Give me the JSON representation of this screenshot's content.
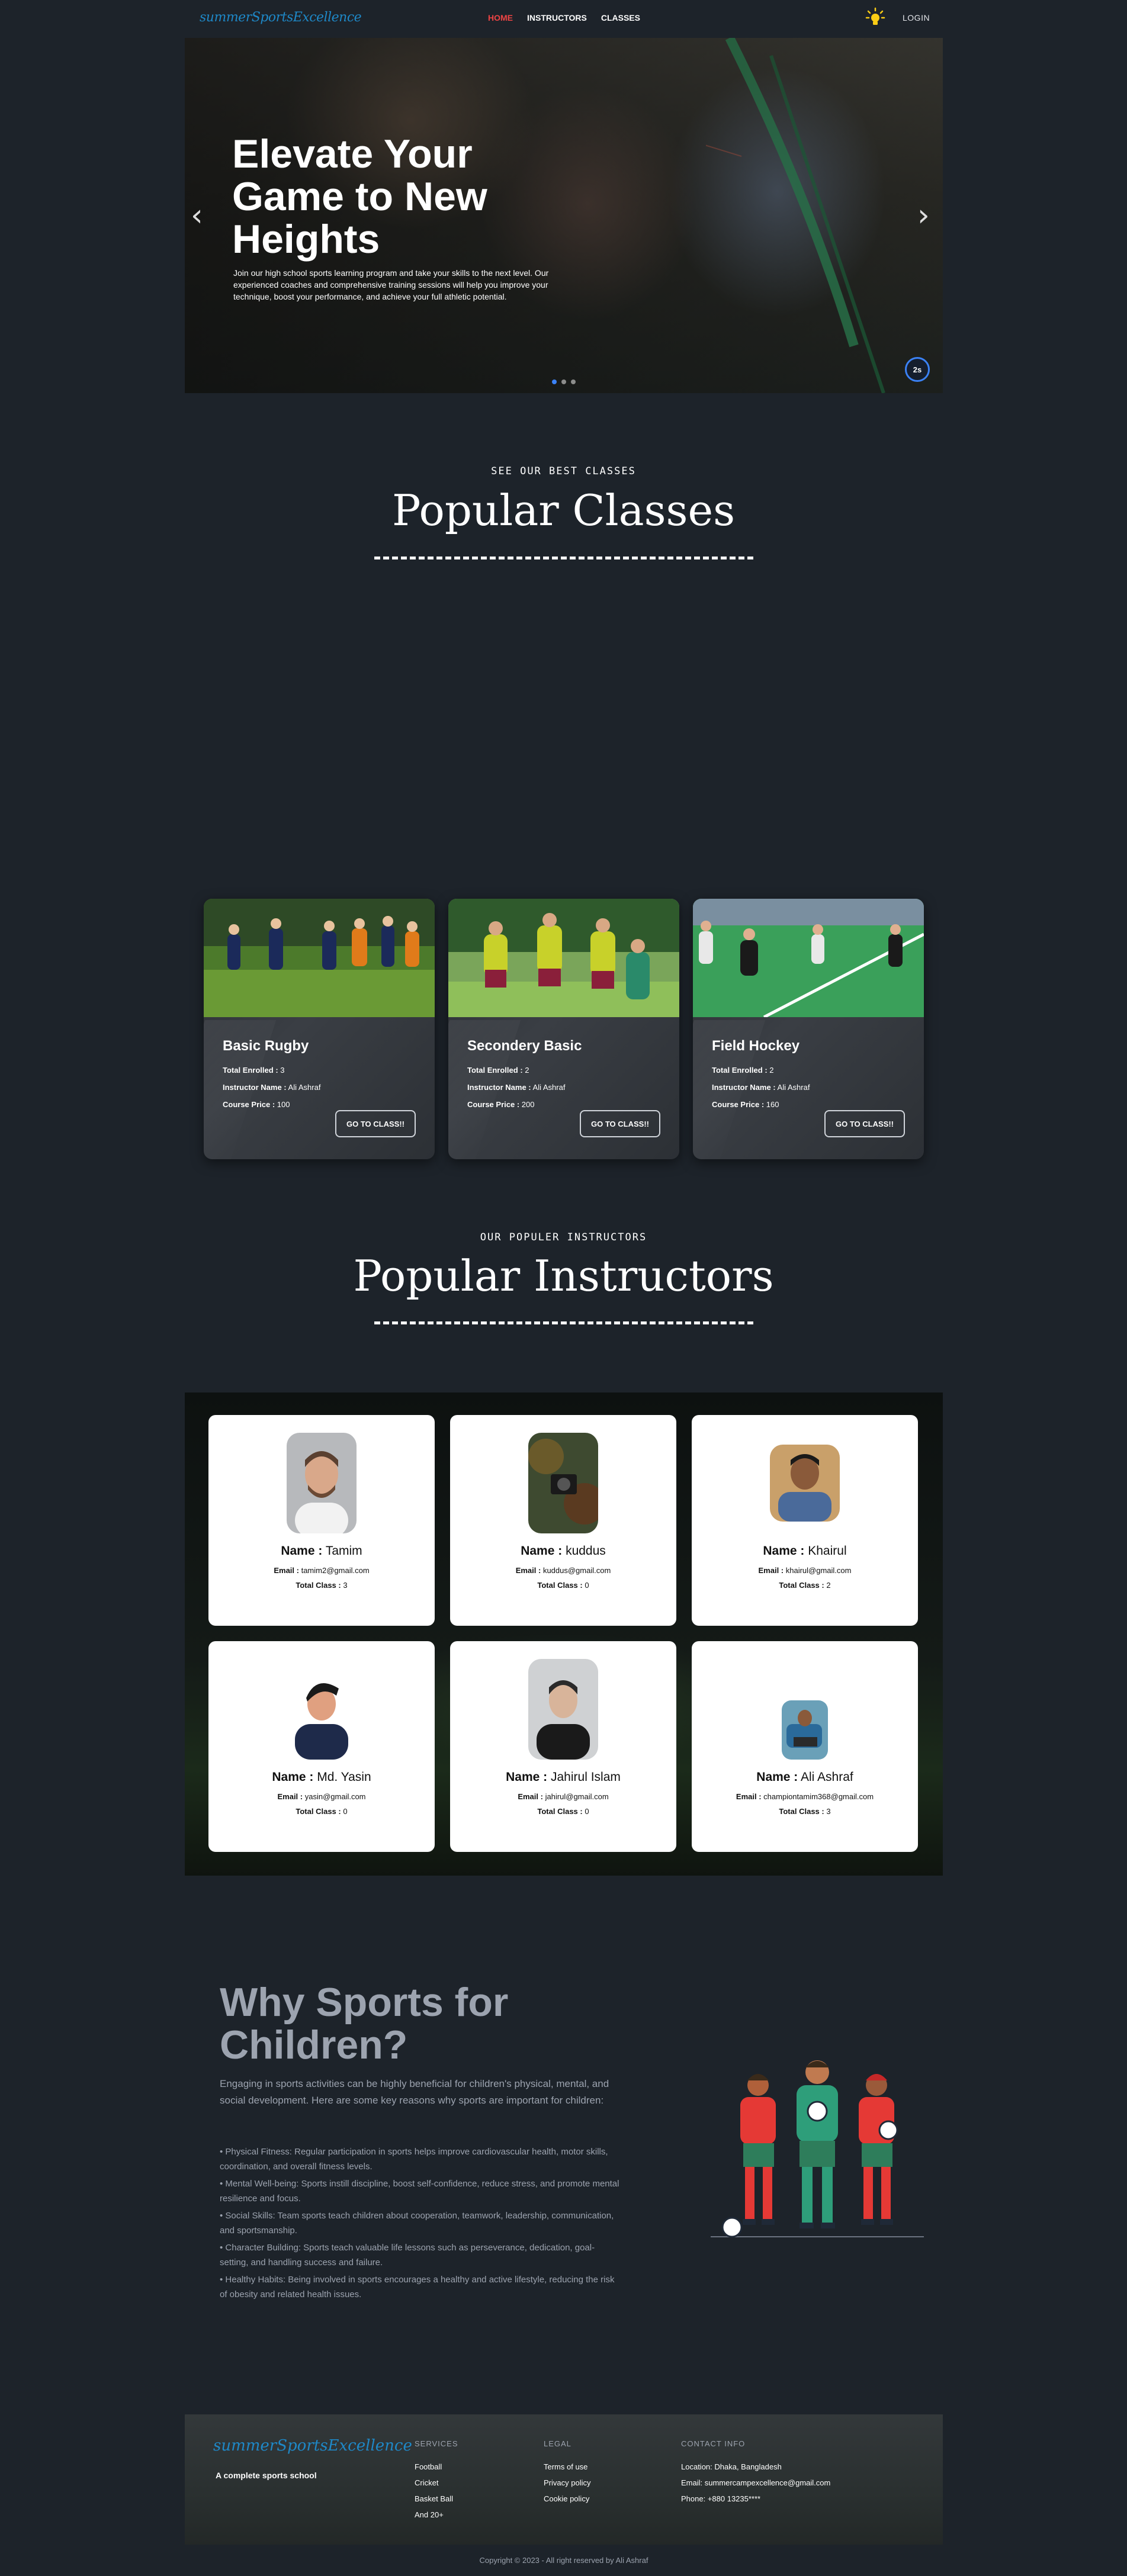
{
  "nav": {
    "logo": "summerSportsExcellence",
    "links": [
      "HOME",
      "INSTRUCTORS",
      "CLASSES"
    ],
    "login": "LOGIN"
  },
  "hero": {
    "title": "Elevate Your Game to New Heights",
    "text": "Join our high school sports learning program and take your skills to the next level. Our experienced coaches and comprehensive training sessions will help you improve your technique, boost your performance, and achieve your full athletic potential.",
    "timer": "2s",
    "prev_icon": "chevron-left-icon",
    "next_icon": "chevron-right-icon"
  },
  "classes_section": {
    "kicker": "SEE OUR BEST CLASSES",
    "title": "Popular Classes",
    "labels": {
      "enrolled": "Total Enrolled :",
      "instructor": "Instructor Name :",
      "price": "Course Price :"
    },
    "cards": [
      {
        "name": "Basic Rugby",
        "enrolled": "3",
        "instructor": "Ali Ashraf",
        "price": "100",
        "button": "GO TO CLASS!!"
      },
      {
        "name": "Secondery Basic",
        "enrolled": "2",
        "instructor": "Ali Ashraf",
        "price": "200",
        "button": "GO TO CLASS!!"
      },
      {
        "name": "Field Hockey",
        "enrolled": "2",
        "instructor": "Ali Ashraf",
        "price": "160",
        "button": "GO TO CLASS!!"
      }
    ]
  },
  "instructors_section": {
    "kicker": "OUR POPULER INSTRUCTORS",
    "title": "Popular Instructors",
    "labels": {
      "name": "Name :",
      "email": "Email :",
      "total": "Total Class :"
    },
    "cards": [
      {
        "name": "Tamim",
        "email": "tamim2@gmail.com",
        "total": "3"
      },
      {
        "name": "kuddus",
        "email": "kuddus@gmail.com",
        "total": "0"
      },
      {
        "name": "Khairul",
        "email": "khairul@gmail.com",
        "total": "2"
      },
      {
        "name": "Md. Yasin",
        "email": "yasin@gmail.com",
        "total": "0"
      },
      {
        "name": "Jahirul Islam",
        "email": "jahirul@gmail.com",
        "total": "0"
      },
      {
        "name": "Ali Ashraf",
        "email": "championtamim368@gmail.com",
        "total": "3"
      }
    ]
  },
  "why": {
    "title": "Why Sports for Children?",
    "intro": "Engaging in sports activities can be highly beneficial for children's physical, mental, and social development. Here are some key reasons why sports are important for children:",
    "points": [
      "• Physical Fitness: Regular participation in sports helps improve cardiovascular health, motor skills, coordination, and overall fitness levels.",
      "• Mental Well-being: Sports instill discipline, boost self-confidence, reduce stress, and promote mental resilience and focus.",
      "• Social Skills: Team sports teach children about cooperation, teamwork, leadership, communication, and sportsmanship.",
      "• Character Building: Sports teach valuable life lessons such as perseverance, dedication, goal-setting, and handling success and failure.",
      "• Healthy Habits: Being involved in sports encourages a healthy and active lifestyle, reducing the risk of obesity and related health issues."
    ]
  },
  "footer": {
    "logo": "summerSportsExcellence",
    "tagline": "A complete sports school",
    "services_head": "SERVICES",
    "services": [
      "Football",
      "Cricket",
      "Basket Ball",
      "And 20+"
    ],
    "legal_head": "LEGAL",
    "legal": [
      "Terms of use",
      "Privacy policy",
      "Cookie policy"
    ],
    "contact_head": "CONTACT INFO",
    "contact": [
      "Location: Dhaka, Bangladesh",
      "Email: summercampexcellence@gmail.com",
      "Phone: +880 13235****"
    ],
    "copyright": "Copyright © 2023 - All right reserved by Ali Ashraf"
  },
  "colors": {
    "page_bg": "#1d232a",
    "active_nav": "#ef4444",
    "accent_blue": "#3b82f6",
    "logo_blue": "#1e88c7",
    "muted_text": "#9ca3af"
  }
}
